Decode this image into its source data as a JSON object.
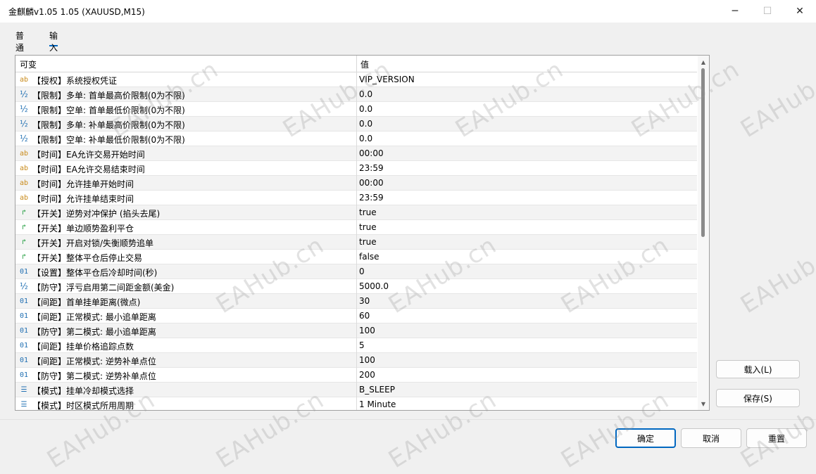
{
  "window": {
    "title": "金麒麟v1.05 1.05 (XAUUSD,M15)",
    "minimize_glyph": "─",
    "maximize_glyph": "☐",
    "close_glyph": "✕"
  },
  "tabs": [
    {
      "label": "普通",
      "active": false
    },
    {
      "label": "输入",
      "active": true
    }
  ],
  "table": {
    "headers": {
      "name": "可变",
      "value": "值"
    },
    "rows": [
      {
        "icon": "ab",
        "name": "【授权】系统授权凭证",
        "value": "VIP_VERSION"
      },
      {
        "icon": "½",
        "name": "【限制】多单: 首单最高价限制(0为不限)",
        "value": "0.0"
      },
      {
        "icon": "½",
        "name": "【限制】空单: 首单最低价限制(0为不限)",
        "value": "0.0"
      },
      {
        "icon": "½",
        "name": "【限制】多单: 补单最高价限制(0为不限)",
        "value": "0.0"
      },
      {
        "icon": "½",
        "name": "【限制】空单: 补单最低价限制(0为不限)",
        "value": "0.0"
      },
      {
        "icon": "ab",
        "name": "【时间】EA允许交易开始时间",
        "value": "00:00"
      },
      {
        "icon": "ab",
        "name": "【时间】EA允许交易结束时间",
        "value": "23:59"
      },
      {
        "icon": "ab",
        "name": "【时间】允许挂单开始时间",
        "value": "00:00"
      },
      {
        "icon": "ab",
        "name": "【时间】允许挂单结束时间",
        "value": "23:59"
      },
      {
        "icon": "↱",
        "name": "【开关】逆势对冲保护 (掐头去尾)",
        "value": "true"
      },
      {
        "icon": "↱",
        "name": "【开关】单边顺势盈利平仓",
        "value": "true"
      },
      {
        "icon": "↱",
        "name": "【开关】开启对锁/失衡顺势追单",
        "value": "true"
      },
      {
        "icon": "↱",
        "name": "【开关】整体平仓后停止交易",
        "value": "false"
      },
      {
        "icon": "01",
        "name": "【设置】整体平仓后冷却时间(秒)",
        "value": "0"
      },
      {
        "icon": "½",
        "name": "【防守】浮亏启用第二间距金额(美金)",
        "value": "5000.0"
      },
      {
        "icon": "01",
        "name": "【间距】首单挂单距离(微点)",
        "value": "30"
      },
      {
        "icon": "01",
        "name": "【间距】正常模式: 最小追单距离",
        "value": "60"
      },
      {
        "icon": "01",
        "name": "【防守】第二模式: 最小追单距离",
        "value": "100"
      },
      {
        "icon": "01",
        "name": "【间距】挂单价格追踪点数",
        "value": "5"
      },
      {
        "icon": "01",
        "name": "【间距】正常模式: 逆势补单点位",
        "value": "100"
      },
      {
        "icon": "01",
        "name": "【防守】第二模式: 逆势补单点位",
        "value": "200"
      },
      {
        "icon": "☰",
        "name": "【模式】挂单冷却模式选择",
        "value": "B_SLEEP"
      },
      {
        "icon": "☰",
        "name": "【模式】时区模式所用周期",
        "value": "1 Minute"
      }
    ]
  },
  "side_buttons": {
    "load": "载入(L)",
    "save": "保存(S)"
  },
  "footer_buttons": {
    "ok": "确定",
    "cancel": "取消",
    "reset": "重置"
  },
  "scrollbar": {
    "up_glyph": "▲",
    "down_glyph": "▼"
  },
  "watermark": "EAHub.cn",
  "colors": {
    "accent": "#0067c0",
    "string_icon": "#c88a1a",
    "number_icon": "#1f6fb2",
    "bool_icon": "#1b9b3a"
  }
}
